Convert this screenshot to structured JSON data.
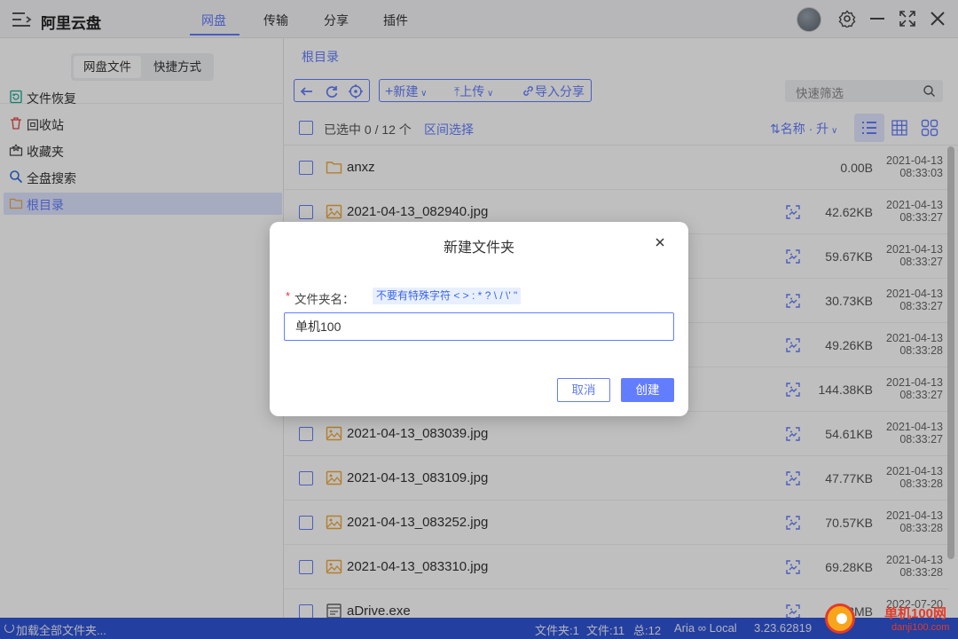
{
  "app": {
    "title": "阿里云盘"
  },
  "nav": {
    "tabs": [
      "网盘",
      "传输",
      "分享",
      "插件"
    ],
    "active": "网盘"
  },
  "sidebar": {
    "segments": [
      "网盘文件",
      "快捷方式"
    ],
    "items": [
      {
        "label": "文件恢复",
        "icon": "file-restore-icon"
      },
      {
        "label": "回收站",
        "icon": "trash-icon"
      },
      {
        "label": "收藏夹",
        "icon": "favorites-icon"
      },
      {
        "label": "全盘搜索",
        "icon": "search-icon"
      },
      {
        "label": "根目录",
        "icon": "folder-icon"
      }
    ],
    "active": "根目录"
  },
  "breadcrumb": "根目录",
  "toolbar": {
    "new_label": "新建",
    "upload_label": "上传",
    "import_label": "导入分享"
  },
  "search": {
    "placeholder": "快速筛选"
  },
  "list_header": {
    "selected": "已选中 0 / 12 个",
    "range_select": "区间选择",
    "sort": "名称 · 升"
  },
  "files": [
    {
      "name": "anxz",
      "type": "folder",
      "size": "0.00B",
      "date": "2021-04-13",
      "time": "08:33:03"
    },
    {
      "name": "2021-04-13_082940.jpg",
      "type": "image",
      "size": "42.62KB",
      "date": "2021-04-13",
      "time": "08:33:27"
    },
    {
      "name": "",
      "type": "image",
      "size": "59.67KB",
      "date": "2021-04-13",
      "time": "08:33:27"
    },
    {
      "name": "",
      "type": "image",
      "size": "30.73KB",
      "date": "2021-04-13",
      "time": "08:33:27"
    },
    {
      "name": "",
      "type": "image",
      "size": "49.26KB",
      "date": "2021-04-13",
      "time": "08:33:28"
    },
    {
      "name": "",
      "type": "image",
      "size": "144.38KB",
      "date": "2021-04-13",
      "time": "08:33:27"
    },
    {
      "name": "2021-04-13_083039.jpg",
      "type": "image",
      "size": "54.61KB",
      "date": "2021-04-13",
      "time": "08:33:27"
    },
    {
      "name": "2021-04-13_083109.jpg",
      "type": "image",
      "size": "47.77KB",
      "date": "2021-04-13",
      "time": "08:33:28"
    },
    {
      "name": "2021-04-13_083252.jpg",
      "type": "image",
      "size": "70.57KB",
      "date": "2021-04-13",
      "time": "08:33:28"
    },
    {
      "name": "2021-04-13_083310.jpg",
      "type": "image",
      "size": "69.28KB",
      "date": "2021-04-13",
      "time": "08:33:28"
    },
    {
      "name": "aDrive.exe",
      "type": "exe",
      "size": "11.3MB",
      "date": "2022-07-20",
      "time": ""
    }
  ],
  "dialog": {
    "title": "新建文件夹",
    "label": "文件夹名：",
    "hint": "不要有特殊字符 < > : * ? \\ / \\' \"",
    "value": "单机100",
    "cancel_label": "取消",
    "create_label": "创建"
  },
  "status": {
    "loading": "加载全部文件夹...",
    "folders": "文件夹:1",
    "files": "文件:11",
    "total": "总:12",
    "aria": "Aria ∞ Local",
    "version": "3.23.62819"
  },
  "watermark": {
    "line1": "单机100网",
    "line2": "danji100.com"
  },
  "colors": {
    "accent": "#637dff",
    "statusbar": "#2f55d6",
    "folder": "#f0a93b"
  }
}
